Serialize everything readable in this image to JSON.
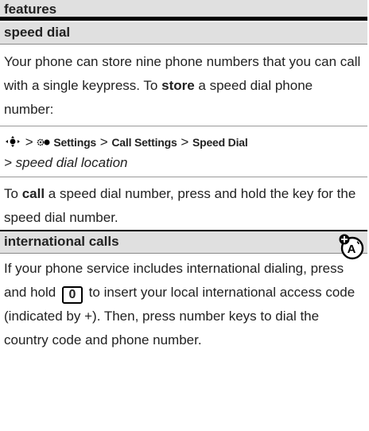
{
  "header": {
    "title": "features"
  },
  "speed_dial": {
    "title": "speed dial",
    "para1_a": "Your phone can store nine phone numbers that you can call with a single keypress. To ",
    "para1_bold": "store",
    "para1_b": " a speed dial phone number:",
    "nav": {
      "sep1": " > ",
      "settings": "Settings",
      "sep2": " > ",
      "call_settings": "Call Settings",
      "sep3": " > ",
      "speed_dial": "Speed Dial"
    },
    "location": "> speed dial location",
    "para2_a": "To ",
    "para2_bold": "call",
    "para2_b": " a speed dial number, press and hold the key for the speed dial number."
  },
  "intl": {
    "title": "international calls",
    "para_a": "If your phone service includes international dialing, press and hold ",
    "key": "0",
    "para_b": " to insert your local international access code (indicated by +). Then, press number keys to dial the country code and phone number.",
    "icon_letter": "A"
  }
}
